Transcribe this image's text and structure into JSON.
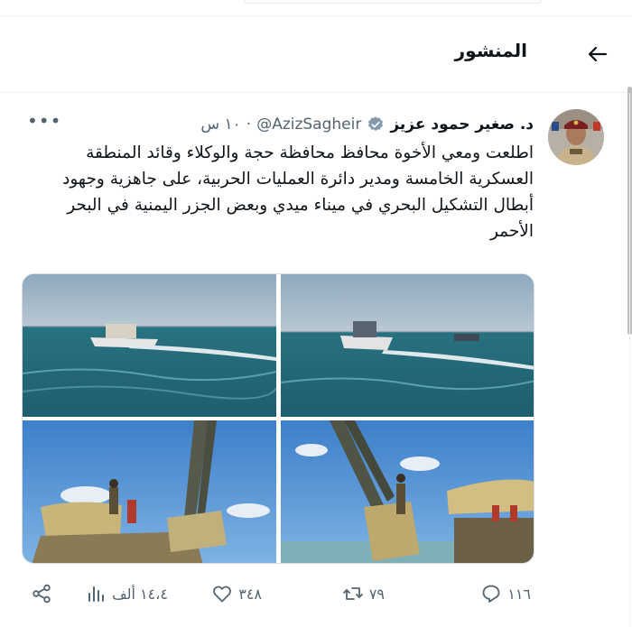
{
  "header": {
    "title": "المنشور",
    "back_icon": "arrow-left-icon"
  },
  "tweet": {
    "author_name": "د. صغير حمود عزيز",
    "handle": "@AzizSagheir",
    "separator": "·",
    "time": "١٠ س",
    "verified_icon": "verified-badge-icon",
    "text": "اطلعت ومعي الأخوة محافظ محافظة حجة والوكلاء وقائد المنطقة العسكرية الخامسة ومدير دائرة العمليات الحربية، على جاهزية وجهود أبطال التشكيل البحري في ميناء ميدي وبعض الجزر اليمنية في البحر الأحمر",
    "more_label": "•••"
  },
  "actions": {
    "replies": "١١٦",
    "retweets": "٧٩",
    "likes": "٣٤٨",
    "views": "١٤،٤ ألف"
  },
  "colors": {
    "text": "#0f1419",
    "muted": "#536471",
    "verified": "#829aab"
  }
}
